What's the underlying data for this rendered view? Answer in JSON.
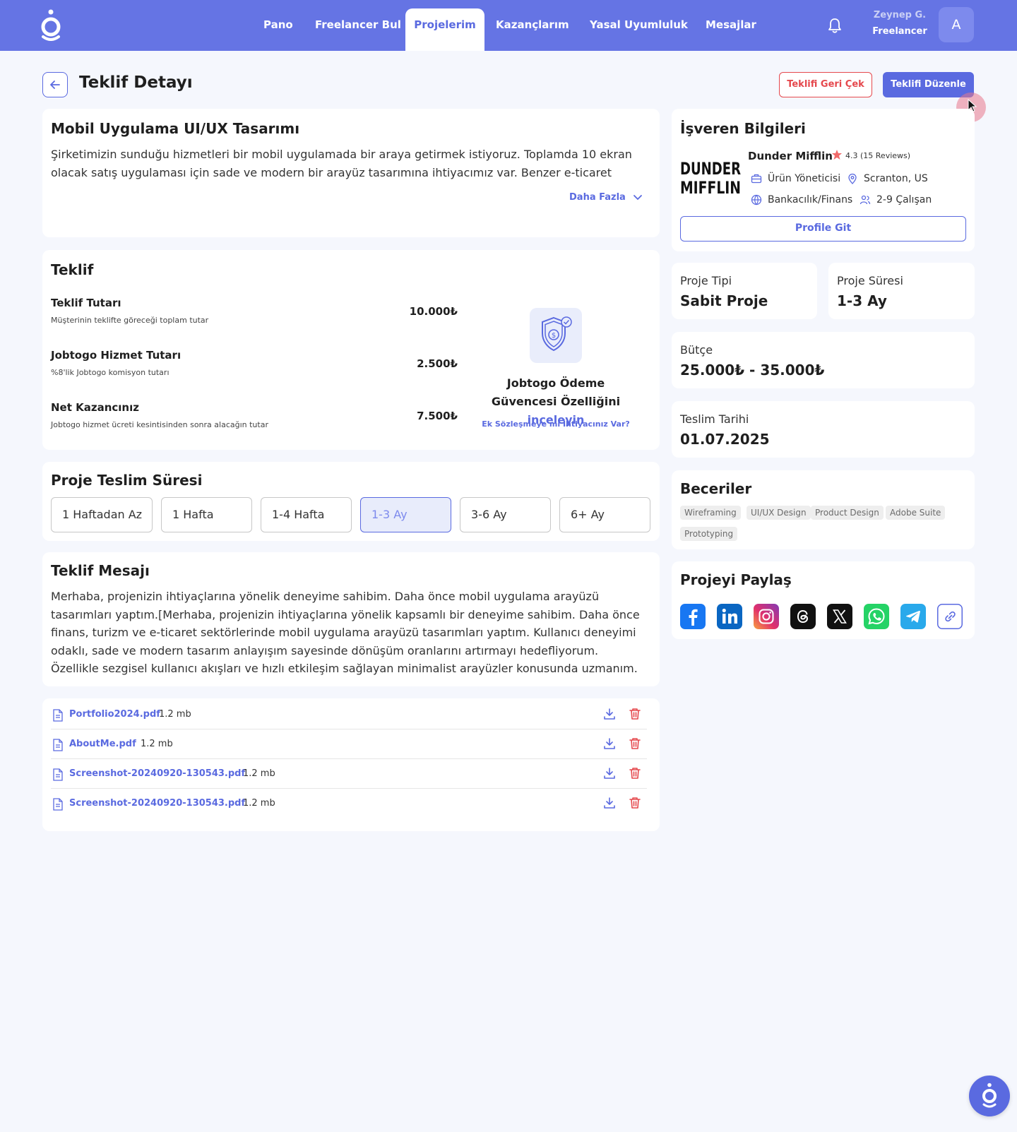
{
  "nav": {
    "links": [
      "Pano",
      "Freelancer Bul",
      "Projelerim",
      "Kazançlarım",
      "Yasal Uyumluluk",
      "Mesajlar"
    ],
    "active": "Projelerim",
    "user_name": "Zeynep G.",
    "user_role": "Freelancer",
    "avatar_letter": "A"
  },
  "header": {
    "title": "Teklif Detayı",
    "withdraw_label": "Teklifi Geri Çek",
    "edit_label": "Teklifi Düzenle"
  },
  "project": {
    "title": "Mobil Uygulama UI/UX Tasarımı",
    "description": "Şirketimizin sunduğu hizmetleri bir mobil uygulamada bir araya getirmek istiyoruz. Toplamda 10 ekran olacak satış uygulaması için sade ve modern bir arayüz tasarımına ihtiyacımız var. Benzer e-ticaret uygulamalarının",
    "more_label": "Daha Fazla"
  },
  "offer": {
    "title": "Teklif",
    "rows": [
      {
        "title": "Teklif Tutarı",
        "sub": "Müşterinin teklifte göreceği toplam tutar",
        "value": "10.000₺"
      },
      {
        "title": "Jobtogo Hizmet Tutarı",
        "sub": "%8'lik Jobtogo komisyon tutarı",
        "value": "2.500₺"
      },
      {
        "title": "Net Kazancınız",
        "sub": "Jobtogo hizmet ücreti kesintisinden sonra alacağın tutar",
        "value": "7.500₺"
      }
    ],
    "guarantee_text": "Jobtogo Ödeme Güvencesi Özelliğini",
    "guarantee_link": "inceleyin",
    "contract_link": "Ek Sözleşmeye mi İhtiyacınız Var?"
  },
  "duration": {
    "title": "Proje Teslim Süresi",
    "options": [
      "1 Haftadan Az",
      "1 Hafta",
      "1-4 Hafta",
      "1-3 Ay",
      "3-6 Ay",
      "6+ Ay"
    ],
    "selected": "1-3 Ay"
  },
  "message": {
    "title": "Teklif Mesajı",
    "text": "Merhaba, projenizin ihtiyaçlarına yönelik  deneyime sahibim. Daha önce mobil uygulama arayüzü tasarımları yaptım.[Merhaba, projenizin ihtiyaçlarına yönelik kapsamlı bir deneyime sahibim. Daha önce finans, turizm ve e-ticaret sektörlerinde mobil uygulama arayüzü tasarımları yaptım. Kullanıcı deneyimi odaklı, sade ve modern tasarım anlayışım sayesinde dönüşüm oranlarını artırmayı hedefliyorum. Özellikle sezgisel kullanıcı akışları ve hızlı etkileşim sağlayan minimalist arayüzler konusunda uzmanım. Daha önce tasarladığım no-code altyapılı..."
  },
  "files": [
    {
      "name": "Portfolio2024.pdf",
      "size": "1.2 mb"
    },
    {
      "name": "AboutMe.pdf",
      "size": "1.2 mb"
    },
    {
      "name": "Screenshot-20240920-130543.pdf",
      "size": "1.2 mb"
    },
    {
      "name": "Screenshot-20240920-130543.pdf",
      "size": "1.2 mb"
    }
  ],
  "employer": {
    "title": "İşveren Bilgileri",
    "logo_text_1": "DUNDER",
    "logo_text_2": "MIFFLIN",
    "name": "Dunder Mifflin",
    "rating": "4.3 (15 Reviews)",
    "role": "Ürün Yöneticisi",
    "location": "Scranton, US",
    "industry": "Bankacılık/Finans",
    "employees": "2-9 Çalışan",
    "profile_label": "Profile Git"
  },
  "project_type": {
    "label": "Proje Tipi",
    "value": "Sabit Proje"
  },
  "project_duration": {
    "label": "Proje Süresi",
    "value": "1-3 Ay"
  },
  "budget": {
    "label": "Bütçe",
    "value": "25.000₺ - 35.000₺"
  },
  "deadline": {
    "label": "Teslim Tarihi",
    "value": "01.07.2025"
  },
  "skills": {
    "title": "Beceriler",
    "items": [
      "Wireframing",
      "UI/UX Design",
      "Product Design",
      "Adobe Suite",
      "Prototyping"
    ]
  },
  "share": {
    "title": "Projeyi Paylaş",
    "icons": [
      "facebook-icon",
      "linkedin-icon",
      "instagram-icon",
      "threads-icon",
      "x-icon",
      "whatsapp-icon",
      "telegram-icon",
      "link-icon"
    ]
  },
  "colors": {
    "primary": "#5a6ae0",
    "nav": "#6574e4",
    "danger": "#e5484d",
    "page": "#f5f7fd"
  }
}
